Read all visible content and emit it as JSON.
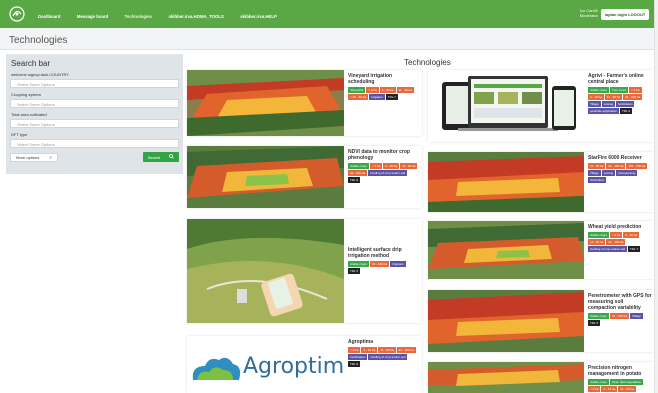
{
  "nav": {
    "items": [
      "Dashboard",
      "Message board",
      "Technologies",
      "skibber.irva.HOMA_TOOLS",
      "skibber.irva.HELP"
    ],
    "user_name": "Ivo Carrilli",
    "user_role": "Moderator",
    "login_btn": "luplan login LOGOUT"
  },
  "page": {
    "title": "Technologies"
  },
  "search": {
    "title": "Search bar",
    "country_label": "welcome.signup.task.COUNTRY",
    "country_placeholder": "Select Some Options",
    "crop_label": "Cropping system",
    "crop_placeholder": "Select Some Options",
    "area_label": "Total area cultivated",
    "area_placeholder": "Select Some Options",
    "dft_label": "DFT type",
    "dft_placeholder": "Select Some Options",
    "more_options": "More options",
    "more_icon": "≡",
    "search_btn": "Search",
    "search_icon": "🔍"
  },
  "main": {
    "title": "Technologies"
  },
  "cards": [
    {
      "title": "Vineyard irrigation scheduling",
      "tags": [
        [
          "Vineyards",
          "g"
        ],
        [
          "< 2 ha",
          "o"
        ],
        [
          "2 - 10 ha",
          "o"
        ],
        [
          "11 - 30 ha",
          "o"
        ],
        [
          "> 31 - 50 ha",
          "o"
        ],
        [
          "Irrigation",
          "p"
        ],
        [
          "TRL 7",
          "k"
        ]
      ]
    },
    {
      "title": "NDVI data to monitor crop phenology",
      "tags": [
        [
          "Arable crops",
          "g"
        ],
        [
          "< 2 ha",
          "o"
        ],
        [
          "2 - 10 ha",
          "o"
        ],
        [
          "11 - 30 ha",
          "o"
        ],
        [
          "31 - 100 ha",
          "o"
        ],
        [
          "Guiding of crop and/or soil",
          "p"
        ],
        [
          "TRL 9",
          "k"
        ]
      ]
    },
    {
      "title": "Intelligent surface drip irrigation method",
      "tags": [
        [
          "Arable crops",
          "g"
        ],
        [
          "31 - 100 ha",
          "o"
        ],
        [
          "Irrigation",
          "p"
        ],
        [
          "TRL 5",
          "k"
        ]
      ]
    },
    {
      "title": "Agroptima",
      "tags": [
        [
          "< 2 ha",
          "o"
        ],
        [
          "2 - 10 ha",
          "o"
        ],
        [
          "11 - 30 ha",
          "o"
        ],
        [
          "31 - 100 ha",
          "o"
        ],
        [
          "Fertilization",
          "p"
        ],
        [
          "Guiding of crop and/or soil",
          "p"
        ],
        [
          "TRL 9",
          "k"
        ]
      ]
    },
    {
      "title": "Agrivi - Farmer's online central place",
      "tags": [
        [
          "Arable crops",
          "g"
        ],
        [
          "Tree crops",
          "g"
        ],
        [
          "< 2 ha",
          "o"
        ],
        [
          "2 - 10 ha",
          "o"
        ],
        [
          "11 - 30 ha",
          "o"
        ],
        [
          "31 - 100 ha",
          "o"
        ],
        [
          "Tillage",
          "p"
        ],
        [
          "sowing",
          "p"
        ],
        [
          "fertilization",
          "p"
        ],
        [
          "pesticide application",
          "p"
        ],
        [
          "TRL 9",
          "k"
        ]
      ]
    },
    {
      "title": "StarFire 6000 Receiver",
      "tags": [
        [
          "11 - 30 ha",
          "o"
        ],
        [
          "31 - 100 ha",
          "o"
        ],
        [
          "101 - 500 ha",
          "o"
        ],
        [
          "Tillage",
          "p"
        ],
        [
          "sowing",
          "p"
        ],
        [
          "transplanting",
          "p"
        ],
        [
          "fertilization",
          "p"
        ]
      ]
    },
    {
      "title": "Wheat yield prediction",
      "tags": [
        [
          "Arable crops",
          "g"
        ],
        [
          "< 2 ha",
          "o"
        ],
        [
          "2 - 10 ha",
          "o"
        ],
        [
          "11 - 30 ha",
          "o"
        ],
        [
          "31 - 100 ha",
          "o"
        ],
        [
          "Guiding of crop and/or soil",
          "p"
        ],
        [
          "TRL 7",
          "k"
        ]
      ]
    },
    {
      "title": "Penetrometer with GPS for measuring soil compaction variability",
      "tags": [
        [
          "Arable crops",
          "g"
        ],
        [
          "31 - 100 ha",
          "o"
        ],
        [
          "Tillage",
          "p"
        ],
        [
          "TRL 5",
          "k"
        ]
      ]
    },
    {
      "title": "Precision nitrogen management in potato",
      "tags": [
        [
          "Arable crops",
          "g"
        ],
        [
          "Open field vegetables",
          "g"
        ],
        [
          "< 2 ha",
          "o"
        ],
        [
          "2 - 10 ha",
          "o"
        ],
        [
          "11 - 30 ha",
          "o"
        ]
      ]
    }
  ],
  "agroptima_logo": "Agroptima",
  "colors": {
    "topbar": "#5aa845",
    "tag_green": "#38a84e",
    "tag_orange": "#e8693a",
    "tag_purple": "#5a54a6",
    "tag_black": "#222222"
  }
}
